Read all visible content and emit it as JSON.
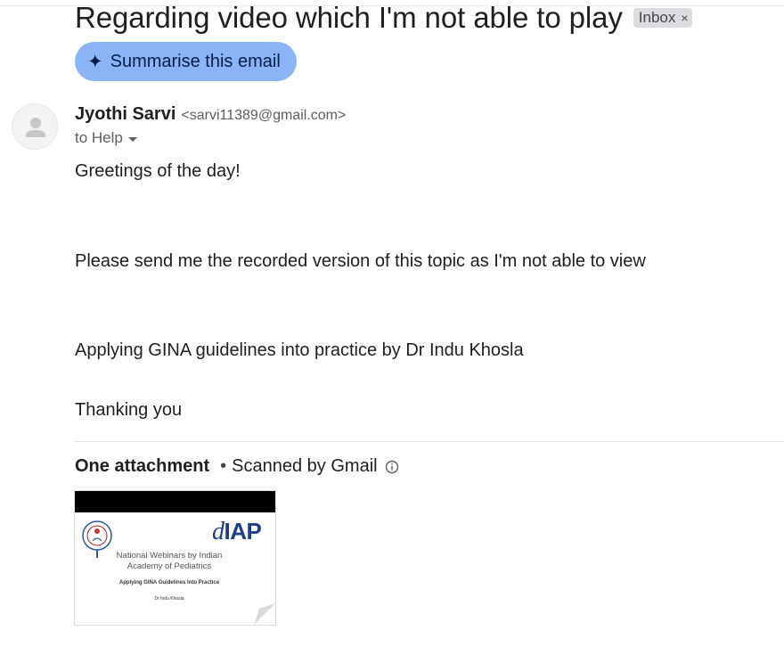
{
  "email": {
    "subject": "Regarding video which I'm not able to play",
    "label": "Inbox",
    "label_remove": "×",
    "summarise_label": "Summarise this email",
    "summarise_icon": "sparkle-icon",
    "sender": {
      "name": "Jyothi Sarvi",
      "email": "<sarvi11389@gmail.com>",
      "to": "to Help"
    },
    "body": {
      "greeting": "Greetings of the day!",
      "request": "Please send me the recorded version of this topic as I'm not able to view",
      "topic": "Applying GINA guidelines into practice by Dr Indu Khosla",
      "closing": "Thanking you"
    },
    "attachments": {
      "title": "One attachment",
      "separator": "•",
      "scanned": "Scanned by Gmail",
      "thumbnail": {
        "logo_prefix": "d",
        "logo_text": "IAP",
        "line1": "National Webinars by Indian",
        "line2": "Academy of Pediatrics",
        "line3": "Applying GINA Guidelines Into Practice",
        "line4": "Dr Indu Khosla"
      }
    }
  },
  "colors": {
    "summarise_bg": "#8ab4f8",
    "label_bg": "#dadce0",
    "logo_blue": "#1b3f8b",
    "text": "#1f1f1f",
    "muted": "#5e5e5e"
  }
}
